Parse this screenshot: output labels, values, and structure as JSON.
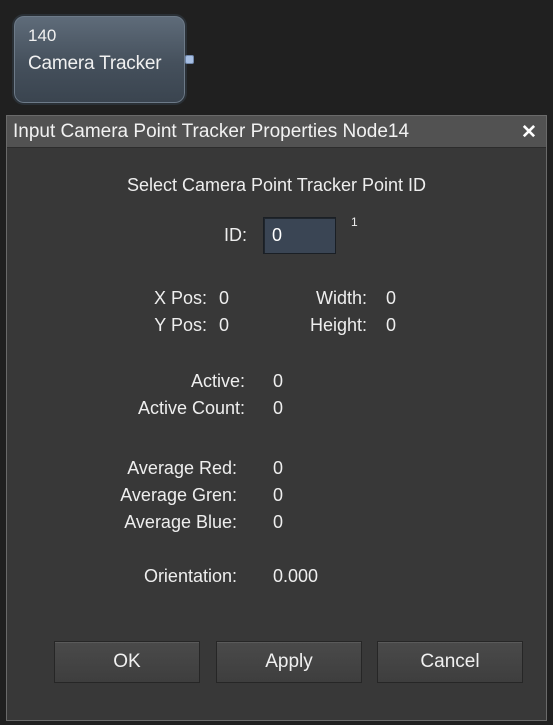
{
  "node": {
    "number": "140",
    "name": "Camera Tracker"
  },
  "dialog": {
    "title": "Input Camera Point Tracker Properties Node14",
    "close_glyph": "✕",
    "heading": "Select Camera Point Tracker Point ID",
    "id_label": "ID:",
    "id_value": "0",
    "id_superscript": "1",
    "x_pos_label": "X Pos:",
    "x_pos_value": "0",
    "y_pos_label": "Y Pos:",
    "y_pos_value": "0",
    "width_label": "Width:",
    "width_value": "0",
    "height_label": "Height:",
    "height_value": "0",
    "active_label": "Active:",
    "active_value": "0",
    "active_count_label": "Active Count:",
    "active_count_value": "0",
    "avg_red_label": "Average Red:",
    "avg_red_value": "0",
    "avg_green_label": "Average Gren:",
    "avg_green_value": "0",
    "avg_blue_label": "Average Blue:",
    "avg_blue_value": "0",
    "orientation_label": "Orientation:",
    "orientation_value": "0.000",
    "buttons": {
      "ok": "OK",
      "apply": "Apply",
      "cancel": "Cancel"
    }
  }
}
